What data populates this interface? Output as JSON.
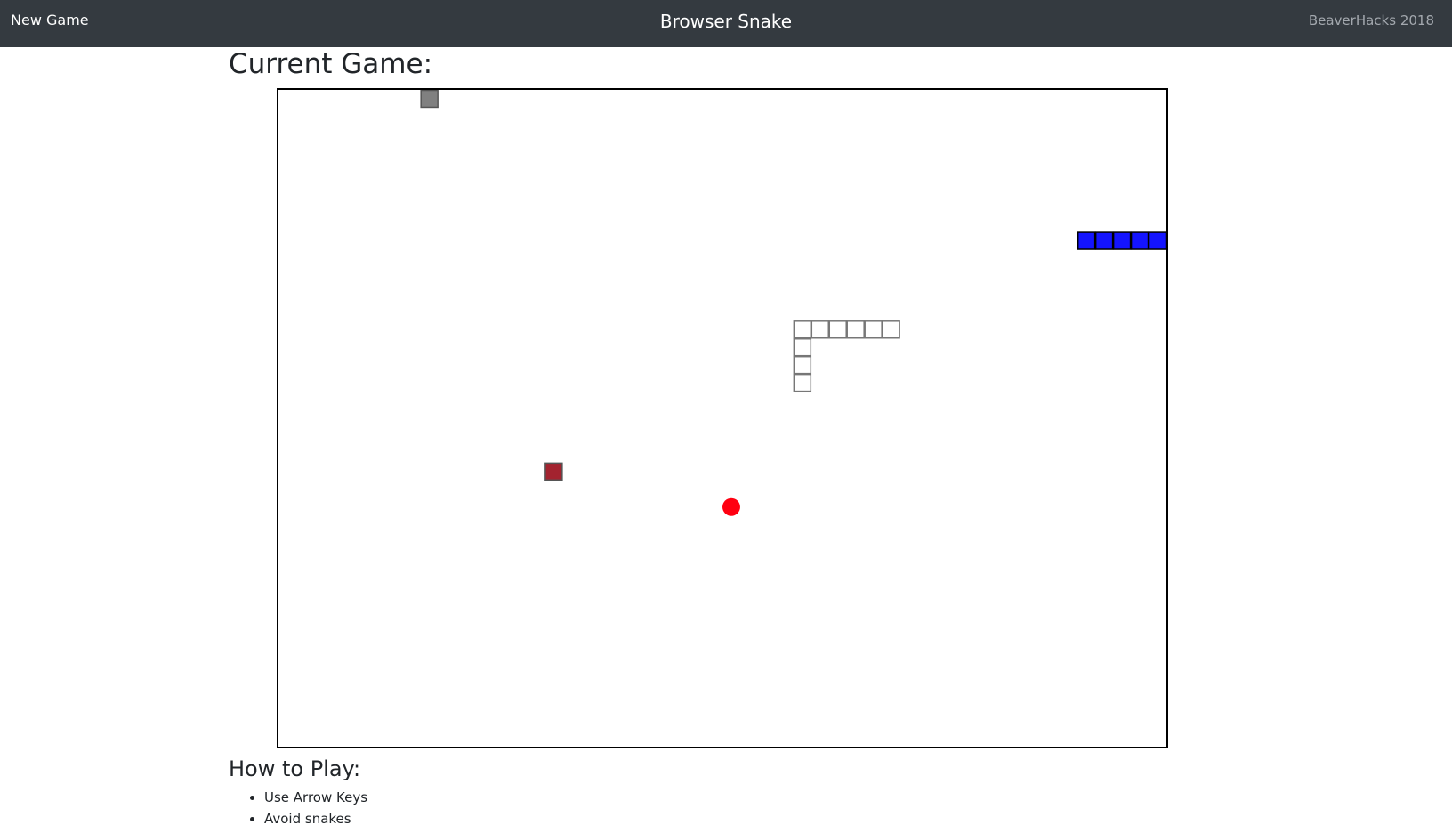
{
  "navbar": {
    "new_game": "New Game",
    "title": "Browser Snake",
    "right_text": "BeaverHacks 2018"
  },
  "main": {
    "heading": "Current Game:"
  },
  "how_to": {
    "heading": "How to Play:",
    "items": [
      "Use Arrow Keys",
      "Avoid snakes"
    ]
  },
  "game": {
    "cols": 50,
    "rows": 37,
    "colors": {
      "player": "#1414ff",
      "enemy_snake_outline": "#777777",
      "gray_block": "#808080",
      "red_block": "#a3232f",
      "food": "#ff0011"
    },
    "player_snake": [
      [
        45,
        8
      ],
      [
        46,
        8
      ],
      [
        47,
        8
      ],
      [
        48,
        8
      ],
      [
        49,
        8
      ]
    ],
    "enemy_snake": [
      [
        29,
        13
      ],
      [
        30,
        13
      ],
      [
        31,
        13
      ],
      [
        32,
        13
      ],
      [
        33,
        13
      ],
      [
        34,
        13
      ],
      [
        29,
        14
      ],
      [
        29,
        15
      ],
      [
        29,
        16
      ]
    ],
    "gray_blocks": [
      [
        8,
        0
      ]
    ],
    "red_blocks": [
      [
        15,
        21
      ]
    ],
    "food": [
      [
        25,
        23
      ]
    ]
  }
}
